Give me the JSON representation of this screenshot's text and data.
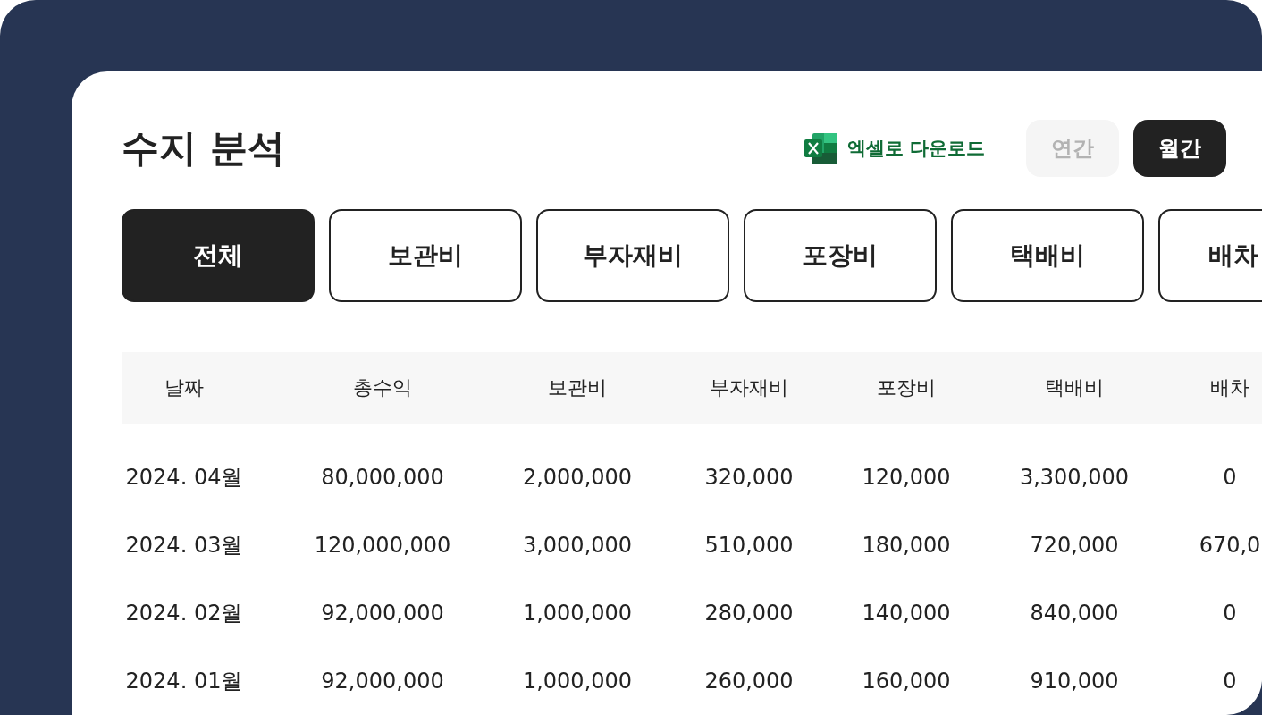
{
  "title": "수지 분석",
  "excel_download": {
    "label": "엑셀로 다운로드"
  },
  "period_toggle": [
    {
      "label": "연간",
      "selected": false
    },
    {
      "label": "월간",
      "selected": true
    }
  ],
  "category_tabs": [
    {
      "label": "전체",
      "selected": true
    },
    {
      "label": "보관비",
      "selected": false
    },
    {
      "label": "부자재비",
      "selected": false
    },
    {
      "label": "포장비",
      "selected": false
    },
    {
      "label": "택배비",
      "selected": false
    },
    {
      "label": "배차",
      "selected": false
    }
  ],
  "table": {
    "columns": [
      "날짜",
      "총수익",
      "보관비",
      "부자재비",
      "포장비",
      "택배비",
      "배차"
    ],
    "rows": [
      [
        "2024. 04월",
        "80,000,000",
        "2,000,000",
        "320,000",
        "120,000",
        "3,300,000",
        "0"
      ],
      [
        "2024. 03월",
        "120,000,000",
        "3,000,000",
        "510,000",
        "180,000",
        "720,000",
        "670,0"
      ],
      [
        "2024. 02월",
        "92,000,000",
        "1,000,000",
        "280,000",
        "140,000",
        "840,000",
        "0"
      ],
      [
        "2024. 01월",
        "92,000,000",
        "1,000,000",
        "260,000",
        "160,000",
        "910,000",
        "0"
      ]
    ]
  }
}
